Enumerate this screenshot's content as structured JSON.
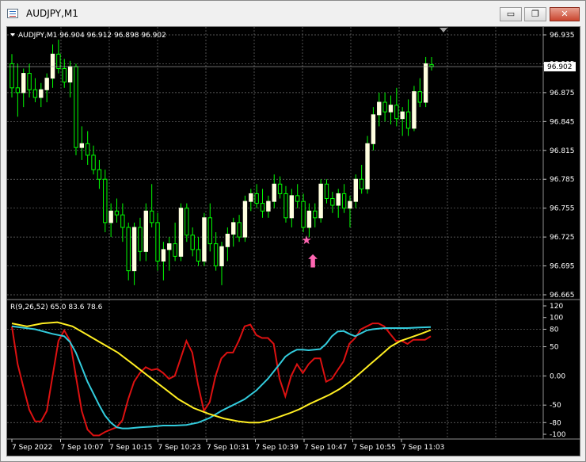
{
  "window": {
    "title": "AUDJPY,M1",
    "icon": "chart-window-icon",
    "controls": {
      "minimize": "▭",
      "restore": "❐",
      "close": "✕"
    }
  },
  "main_chart": {
    "header": "AUDJPY,M1  96.904 96.912 96.898 96.902",
    "price_labels": [
      "96.935",
      "96.905",
      "96.875",
      "96.845",
      "96.815",
      "96.785",
      "96.755",
      "96.725",
      "96.695",
      "96.665"
    ],
    "current_price": "96.902",
    "colors": {
      "bull": "#ffffe0",
      "bear": "#00ff00",
      "wick": "#00ff00",
      "grid": "#707070"
    },
    "markers": [
      {
        "name": "star-icon",
        "glyph": "★",
        "color": "#ff66b2",
        "price": 96.722
      },
      {
        "name": "arrow-up-icon",
        "glyph": "⬆",
        "color": "#ff66b2",
        "price": 96.7
      }
    ]
  },
  "indicator": {
    "header": "R(9,26,52) 65.0 83.6 78.6",
    "level_labels": [
      "120",
      "100",
      "80",
      "50",
      "0.00",
      "-50",
      "-80",
      "-100"
    ],
    "series": [
      {
        "name": "fast",
        "color": "#dd1111",
        "last": 65.0
      },
      {
        "name": "mid",
        "color": "#33ccdd",
        "last": 83.6
      },
      {
        "name": "slow",
        "color": "#ffee22",
        "last": 78.6
      }
    ]
  },
  "time_labels": [
    "7 Sep 2022",
    "7 Sep 10:07",
    "7 Sep 10:15",
    "7 Sep 10:23",
    "7 Sep 10:31",
    "7 Sep 10:39",
    "7 Sep 10:47",
    "7 Sep 10:55",
    "7 Sep 11:03"
  ],
  "chart_data": [
    {
      "type": "candlestick",
      "title": "AUDJPY,M1",
      "ylim": [
        96.665,
        96.945
      ],
      "open_high_low_close": [
        [
          96.905,
          96.915,
          96.87,
          96.88
        ],
        [
          96.88,
          96.905,
          96.85,
          96.875
        ],
        [
          96.875,
          96.9,
          96.86,
          96.895
        ],
        [
          96.895,
          96.905,
          96.87,
          96.878
        ],
        [
          96.878,
          96.89,
          96.865,
          96.87
        ],
        [
          96.87,
          96.885,
          96.86,
          96.878
        ],
        [
          96.878,
          96.895,
          96.865,
          96.89
        ],
        [
          96.89,
          96.925,
          96.88,
          96.915
        ],
        [
          96.915,
          96.93,
          96.895,
          96.9
        ],
        [
          96.9,
          96.91,
          96.88,
          96.886
        ],
        [
          96.886,
          96.908,
          96.87,
          96.902
        ],
        [
          96.902,
          96.905,
          96.81,
          96.818
        ],
        [
          96.818,
          96.84,
          96.805,
          96.822
        ],
        [
          96.822,
          96.835,
          96.8,
          96.81
        ],
        [
          96.81,
          96.82,
          96.79,
          96.795
        ],
        [
          96.795,
          96.805,
          96.775,
          96.785
        ],
        [
          96.785,
          96.795,
          96.73,
          96.74
        ],
        [
          96.74,
          96.76,
          96.725,
          96.752
        ],
        [
          96.752,
          96.765,
          96.74,
          96.748
        ],
        [
          96.748,
          96.76,
          96.72,
          96.735
        ],
        [
          96.735,
          96.74,
          96.68,
          96.69
        ],
        [
          96.69,
          96.74,
          96.675,
          96.735
        ],
        [
          96.735,
          96.745,
          96.7,
          96.71
        ],
        [
          96.71,
          96.76,
          96.7,
          96.752
        ],
        [
          96.752,
          96.78,
          96.735,
          96.74
        ],
        [
          96.74,
          96.75,
          96.69,
          96.7
        ],
        [
          96.7,
          96.72,
          96.68,
          96.712
        ],
        [
          96.712,
          96.725,
          96.69,
          96.718
        ],
        [
          96.718,
          96.74,
          96.7,
          96.705
        ],
        [
          96.705,
          96.76,
          96.7,
          96.755
        ],
        [
          96.755,
          96.76,
          96.72,
          96.727
        ],
        [
          96.727,
          96.735,
          96.705,
          96.712
        ],
        [
          96.712,
          96.725,
          96.695,
          96.7
        ],
        [
          96.7,
          96.75,
          96.695,
          96.745
        ],
        [
          96.745,
          96.76,
          96.71,
          96.718
        ],
        [
          96.718,
          96.73,
          96.69,
          96.695
        ],
        [
          96.695,
          96.72,
          96.675,
          96.715
        ],
        [
          96.715,
          96.735,
          96.7,
          96.728
        ],
        [
          96.728,
          96.745,
          96.715,
          96.74
        ],
        [
          96.74,
          96.748,
          96.72,
          96.725
        ],
        [
          96.725,
          96.768,
          96.72,
          96.762
        ],
        [
          96.762,
          96.775,
          96.752,
          96.77
        ],
        [
          96.77,
          96.78,
          96.755,
          96.76
        ],
        [
          96.76,
          96.775,
          96.745,
          96.752
        ],
        [
          96.752,
          96.768,
          96.745,
          96.762
        ],
        [
          96.762,
          96.79,
          96.755,
          96.78
        ],
        [
          96.78,
          96.788,
          96.765,
          96.77
        ],
        [
          96.77,
          96.778,
          96.74,
          96.745
        ],
        [
          96.745,
          96.775,
          96.735,
          96.768
        ],
        [
          96.768,
          96.78,
          96.755,
          96.762
        ],
        [
          96.762,
          96.77,
          96.73,
          96.735
        ],
        [
          96.735,
          96.76,
          96.725,
          96.752
        ],
        [
          96.752,
          96.76,
          96.735,
          96.745
        ],
        [
          96.745,
          96.785,
          96.74,
          96.78
        ],
        [
          96.78,
          96.785,
          96.76,
          96.765
        ],
        [
          96.765,
          96.772,
          96.75,
          96.758
        ],
        [
          96.758,
          96.775,
          96.745,
          96.77
        ],
        [
          96.77,
          96.78,
          96.75,
          96.755
        ],
        [
          96.755,
          96.768,
          96.735,
          96.762
        ],
        [
          96.762,
          96.79,
          96.755,
          96.785
        ],
        [
          96.785,
          96.8,
          96.77,
          96.775
        ],
        [
          96.775,
          96.83,
          96.77,
          96.822
        ],
        [
          96.822,
          96.86,
          96.815,
          96.852
        ],
        [
          96.852,
          96.875,
          96.84,
          96.865
        ],
        [
          96.865,
          96.875,
          96.845,
          96.855
        ],
        [
          96.855,
          96.872,
          96.842,
          96.862
        ],
        [
          96.862,
          96.88,
          96.84,
          96.848
        ],
        [
          96.848,
          96.86,
          96.83,
          96.855
        ],
        [
          96.855,
          96.868,
          96.83,
          96.838
        ],
        [
          96.838,
          96.882,
          96.835,
          96.876
        ],
        [
          96.876,
          96.89,
          96.86,
          96.865
        ],
        [
          96.865,
          96.912,
          96.86,
          96.905
        ],
        [
          96.904,
          96.912,
          96.898,
          96.902
        ]
      ]
    },
    {
      "type": "line",
      "title": "R(9,26,52)",
      "ylim": [
        -105,
        122
      ],
      "x_range": [
        0,
        73
      ],
      "series": [
        {
          "name": "fast",
          "points": [
            [
              0,
              85
            ],
            [
              1,
              20
            ],
            [
              2,
              -20
            ],
            [
              3,
              -58
            ],
            [
              4,
              -78
            ],
            [
              5,
              -78
            ],
            [
              6,
              -60
            ],
            [
              7,
              0
            ],
            [
              8,
              60
            ],
            [
              9,
              78
            ],
            [
              10,
              60
            ],
            [
              11,
              0
            ],
            [
              12,
              -60
            ],
            [
              13,
              -92
            ],
            [
              14,
              -102
            ],
            [
              15,
              -102
            ],
            [
              16,
              -96
            ],
            [
              17,
              -92
            ],
            [
              18,
              -88
            ],
            [
              19,
              -76
            ],
            [
              20,
              -40
            ],
            [
              21,
              -10
            ],
            [
              22,
              5
            ],
            [
              23,
              15
            ],
            [
              24,
              10
            ],
            [
              25,
              12
            ],
            [
              26,
              5
            ],
            [
              27,
              -5
            ],
            [
              28,
              0
            ],
            [
              29,
              30
            ],
            [
              30,
              60
            ],
            [
              31,
              40
            ],
            [
              32,
              -15
            ],
            [
              33,
              -60
            ],
            [
              34,
              -45
            ],
            [
              35,
              0
            ],
            [
              36,
              30
            ],
            [
              37,
              40
            ],
            [
              38,
              40
            ],
            [
              39,
              60
            ],
            [
              40,
              85
            ],
            [
              41,
              88
            ],
            [
              42,
              70
            ],
            [
              43,
              65
            ],
            [
              44,
              65
            ],
            [
              45,
              55
            ],
            [
              46,
              -5
            ],
            [
              47,
              -35
            ],
            [
              48,
              0
            ],
            [
              49,
              20
            ],
            [
              50,
              5
            ],
            [
              51,
              20
            ],
            [
              52,
              30
            ],
            [
              53,
              30
            ],
            [
              54,
              -10
            ],
            [
              55,
              -5
            ],
            [
              56,
              10
            ],
            [
              57,
              25
            ],
            [
              58,
              55
            ],
            [
              59,
              65
            ],
            [
              60,
              80
            ],
            [
              61,
              85
            ],
            [
              62,
              90
            ],
            [
              63,
              90
            ],
            [
              64,
              85
            ],
            [
              65,
              72
            ],
            [
              66,
              60
            ],
            [
              67,
              60
            ],
            [
              68,
              55
            ],
            [
              69,
              62
            ],
            [
              70,
              62
            ],
            [
              71,
              62
            ],
            [
              72,
              68
            ]
          ]
        },
        {
          "name": "mid",
          "points": [
            [
              0,
              85
            ],
            [
              4,
              80
            ],
            [
              7,
              72
            ],
            [
              9,
              68
            ],
            [
              10,
              58
            ],
            [
              11,
              40
            ],
            [
              12,
              15
            ],
            [
              13,
              -10
            ],
            [
              14,
              -30
            ],
            [
              15,
              -50
            ],
            [
              16,
              -68
            ],
            [
              17,
              -80
            ],
            [
              18,
              -88
            ],
            [
              19,
              -90
            ],
            [
              20,
              -90
            ],
            [
              22,
              -88
            ],
            [
              24,
              -87
            ],
            [
              26,
              -85
            ],
            [
              28,
              -85
            ],
            [
              30,
              -84
            ],
            [
              32,
              -80
            ],
            [
              34,
              -72
            ],
            [
              36,
              -60
            ],
            [
              38,
              -50
            ],
            [
              40,
              -40
            ],
            [
              42,
              -25
            ],
            [
              44,
              -5
            ],
            [
              46,
              20
            ],
            [
              47,
              33
            ],
            [
              48,
              40
            ],
            [
              49,
              45
            ],
            [
              50,
              45
            ],
            [
              51,
              44
            ],
            [
              52,
              45
            ],
            [
              53,
              46
            ],
            [
              54,
              55
            ],
            [
              55,
              68
            ],
            [
              56,
              76
            ],
            [
              57,
              77
            ],
            [
              58,
              72
            ],
            [
              59,
              68
            ],
            [
              60,
              73
            ],
            [
              61,
              78
            ],
            [
              62,
              80
            ],
            [
              63,
              81
            ],
            [
              64,
              82
            ],
            [
              66,
              82
            ],
            [
              68,
              82
            ],
            [
              70,
              83
            ],
            [
              72,
              83.6
            ]
          ]
        },
        {
          "name": "slow",
          "points": [
            [
              0,
              90
            ],
            [
              3,
              85
            ],
            [
              6,
              90
            ],
            [
              9,
              92
            ],
            [
              12,
              85
            ],
            [
              15,
              70
            ],
            [
              18,
              55
            ],
            [
              21,
              40
            ],
            [
              24,
              20
            ],
            [
              27,
              0
            ],
            [
              30,
              -20
            ],
            [
              33,
              -40
            ],
            [
              36,
              -55
            ],
            [
              39,
              -65
            ],
            [
              42,
              -73
            ],
            [
              45,
              -78
            ],
            [
              47,
              -80
            ],
            [
              49,
              -80
            ],
            [
              51,
              -76
            ],
            [
              53,
              -70
            ],
            [
              55,
              -64
            ],
            [
              57,
              -57
            ],
            [
              59,
              -48
            ],
            [
              61,
              -40
            ],
            [
              63,
              -32
            ],
            [
              65,
              -22
            ],
            [
              67,
              -10
            ],
            [
              69,
              5
            ],
            [
              71,
              20
            ],
            [
              73,
              35
            ],
            [
              75,
              50
            ],
            [
              77,
              60
            ],
            [
              79,
              66
            ],
            [
              81,
              72
            ],
            [
              83,
              78.6
            ]
          ]
        }
      ]
    }
  ]
}
